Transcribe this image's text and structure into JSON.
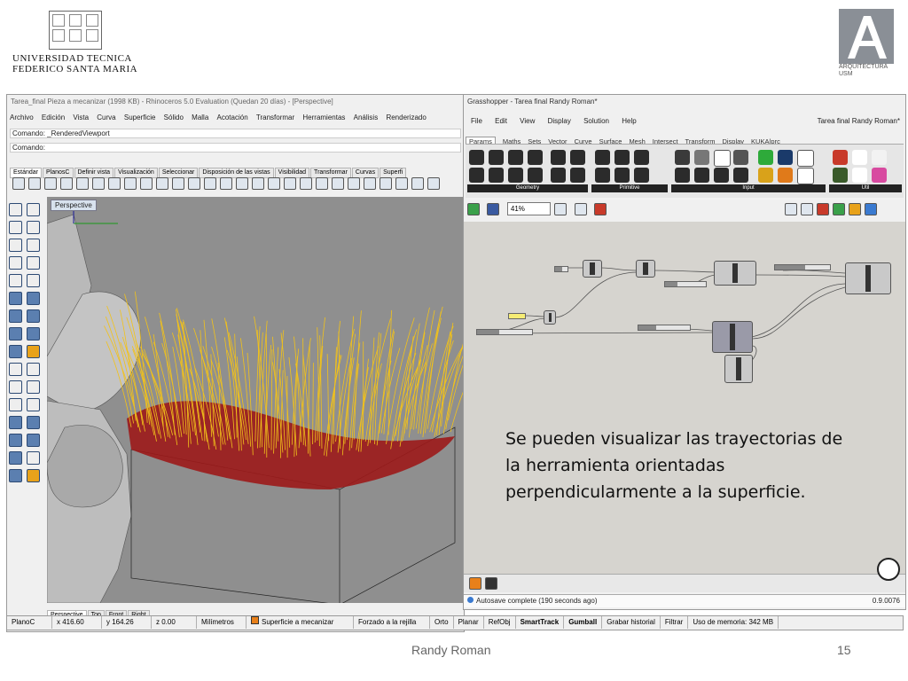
{
  "header": {
    "university_line1": "UNIVERSIDAD TECNICA",
    "university_line2": "FEDERICO SANTA MARIA",
    "arq_line1": "ARQUITECTURA",
    "arq_line2": "USM",
    "arq_letter": "A"
  },
  "rhino": {
    "title": "Tarea_final Pieza a mecanizar (1998 KB) - Rhinoceros 5.0 Evaluation (Quedan 20 días) - [Perspective]",
    "menu": [
      "Archivo",
      "Edición",
      "Vista",
      "Curva",
      "Superficie",
      "Sólido",
      "Malla",
      "Acotación",
      "Transformar",
      "Herramientas",
      "Análisis",
      "Renderizado"
    ],
    "command_history": "Comando: _RenderedViewport",
    "command_prompt": "Comando:",
    "toolbar_tabs": [
      "Estándar",
      "PlanosC",
      "Definir vista",
      "Visualización",
      "Seleccionar",
      "Disposición de las vistas",
      "Visibilidad",
      "Transformar",
      "Curvas",
      "Superfi"
    ],
    "viewport_label": "Perspective",
    "view_tabs": [
      "Perspective",
      "Top",
      "Front",
      "Right"
    ],
    "status": {
      "cplane": "PlanoC",
      "x": "x 416.60",
      "y": "y 164.26",
      "z": "z 0.00",
      "units": "Milímetros",
      "layer": "Superficie a mecanizar",
      "grid_snap": "Forzado a la rejilla",
      "ortho": "Orto",
      "planar": "Planar",
      "osnap": "RefObj",
      "smarttrack": "SmartTrack",
      "gumball": "Gumball",
      "history": "Grabar historial",
      "filter": "Filtrar",
      "memory": "Uso de memoria: 342 MB"
    },
    "colors": {
      "curves_yellow": "#f2c21a",
      "toolpath_red": "#9c1a1a",
      "viewport_bg": "#8f8f8f"
    }
  },
  "grasshopper": {
    "title": "Grasshopper - Tarea final Randy Roman*",
    "menu": [
      "File",
      "Edit",
      "View",
      "Display",
      "Solution",
      "Help"
    ],
    "doc_name": "Tarea final Randy Roman*",
    "tabs": [
      "Params",
      "Maths",
      "Sets",
      "Vector",
      "Curve",
      "Surface",
      "Mesh",
      "Intersect",
      "Transform",
      "Display",
      "KUKA|prc"
    ],
    "groups": [
      "Geometry",
      "Primitive",
      "Input",
      "Util"
    ],
    "zoom": "41%",
    "status_text": "Autosave complete (190 seconds ago)",
    "version": "0.9.0076"
  },
  "caption": {
    "line1": "Se pueden visualizar las trayectorias de",
    "line2": "la herramienta orientadas",
    "line3": "perpendicularmente a la superficie."
  },
  "footer": {
    "author": "Randy Roman",
    "page": "15"
  }
}
